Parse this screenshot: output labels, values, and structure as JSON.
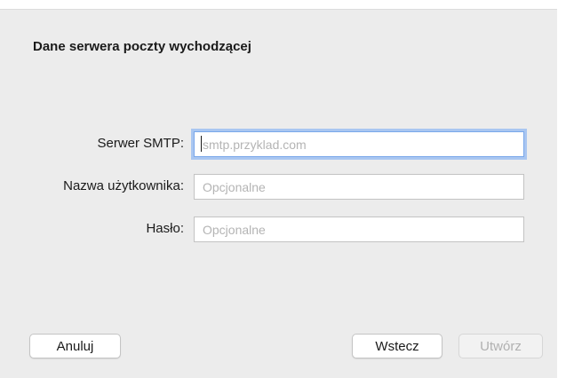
{
  "dialog": {
    "title": "Dane serwera poczty wychodzącej"
  },
  "form": {
    "smtp_server": {
      "label": "Serwer SMTP:",
      "value": "",
      "placeholder": "smtp.przyklad.com"
    },
    "username": {
      "label": "Nazwa użytkownika:",
      "value": "",
      "placeholder": "Opcjonalne"
    },
    "password": {
      "label": "Hasło:",
      "value": "",
      "placeholder": "Opcjonalne"
    }
  },
  "buttons": {
    "cancel_label": "Anuluj",
    "back_label": "Wstecz",
    "create_label": "Utwórz"
  },
  "colors": {
    "dialog_background": "#ececec",
    "focus_ring": "#a9c6f1",
    "disabled_text": "#b0b0b0"
  }
}
